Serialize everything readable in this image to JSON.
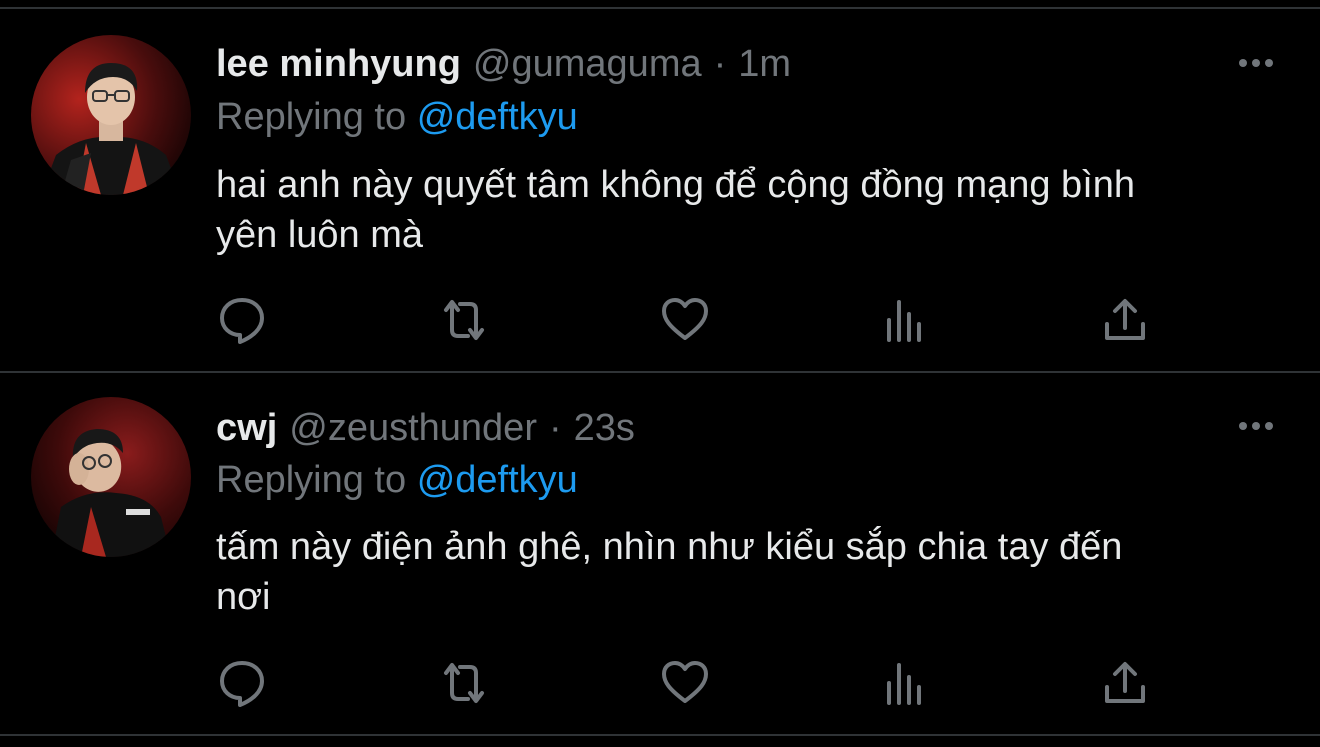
{
  "tweets": [
    {
      "author_name": "lee minhyung",
      "author_handle": "@gumaguma",
      "separator": "·",
      "time": "1m",
      "replying_prefix": "Replying to",
      "replying_to": "@deftkyu",
      "text_line1": "hai anh này quyết tâm không để cộng đồng mạng bình",
      "text_line2": "yên luôn mà",
      "avatar_icon": "profile-photo-avatar",
      "actions": [
        "reply-icon",
        "retweet-icon",
        "like-icon",
        "analytics-icon",
        "share-icon"
      ]
    },
    {
      "author_name": "cwj",
      "author_handle": "@zeusthunder",
      "separator": "·",
      "time": "23s",
      "replying_prefix": "Replying to",
      "replying_to": "@deftkyu",
      "text_line1": "tấm này điện ảnh ghê, nhìn như kiểu sắp chia tay đến",
      "text_line2": "nơi",
      "avatar_icon": "profile-photo-avatar",
      "actions": [
        "reply-icon",
        "retweet-icon",
        "like-icon",
        "analytics-icon",
        "share-icon"
      ]
    }
  ],
  "colors": {
    "background": "#000000",
    "primary_text": "#e7e9ea",
    "secondary_text": "#71767b",
    "accent": "#1d9bf0",
    "divider": "#2f3336"
  }
}
